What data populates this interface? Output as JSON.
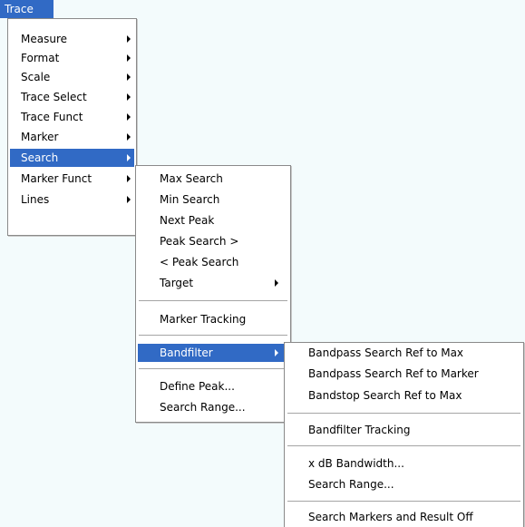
{
  "menubar": {
    "trace_label": "Trace"
  },
  "trace_menu": {
    "items": [
      {
        "label": "Measure"
      },
      {
        "label": "Format"
      },
      {
        "label": "Scale"
      },
      {
        "label": "Trace Select"
      },
      {
        "label": "Trace Funct"
      },
      {
        "label": "Marker"
      },
      {
        "label": "Search",
        "highlighted": true
      },
      {
        "label": "Marker Funct"
      },
      {
        "label": "Lines"
      }
    ]
  },
  "search_menu": {
    "items": [
      {
        "label": "Max Search"
      },
      {
        "label": "Min Search"
      },
      {
        "label": "Next Peak"
      },
      {
        "label": "Peak Search >"
      },
      {
        "label": "< Peak Search"
      },
      {
        "label": "Target"
      },
      {
        "label": "Marker Tracking"
      },
      {
        "label": "Bandfilter",
        "highlighted": true
      },
      {
        "label": "Define Peak..."
      },
      {
        "label": "Search Range..."
      }
    ]
  },
  "bandfilter_menu": {
    "items": [
      {
        "label": "Bandpass Search Ref to Max"
      },
      {
        "label": "Bandpass Search Ref to Marker"
      },
      {
        "label": "Bandstop Search Ref to Max"
      },
      {
        "label": "Bandfilter Tracking"
      },
      {
        "label": "x dB Bandwidth..."
      },
      {
        "label": "Search Range..."
      },
      {
        "label": "Search Markers and Result Off"
      }
    ]
  },
  "colors": {
    "highlight": "#316ac5",
    "background": "#f3fbfc",
    "menu_border": "#8a8a8a"
  }
}
